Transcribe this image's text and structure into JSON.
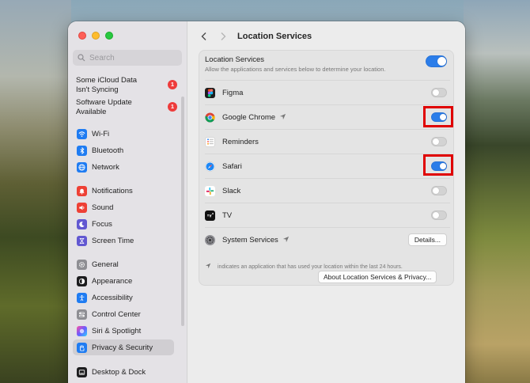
{
  "sidebar": {
    "search_placeholder": "Search",
    "alerts": [
      {
        "line1": "Some iCloud Data",
        "line2": "Isn't Syncing",
        "badge": "1"
      },
      {
        "line1": "Software Update",
        "line2": "Available",
        "badge": "1"
      }
    ],
    "items": [
      {
        "label": "Wi-Fi",
        "icon": "wifi-icon",
        "color": "#1f7cf2"
      },
      {
        "label": "Bluetooth",
        "icon": "bluetooth-icon",
        "color": "#1f7cf2"
      },
      {
        "label": "Network",
        "icon": "globe-icon",
        "color": "#1f7cf2"
      },
      {
        "label": "Notifications",
        "icon": "bell-icon",
        "color": "#ee4035"
      },
      {
        "label": "Sound",
        "icon": "speaker-icon",
        "color": "#ee4035"
      },
      {
        "label": "Focus",
        "icon": "moon-icon",
        "color": "#6258d1"
      },
      {
        "label": "Screen Time",
        "icon": "hourglass-icon",
        "color": "#6258d1"
      },
      {
        "label": "General",
        "icon": "gear-icon",
        "color": "#8e8e93"
      },
      {
        "label": "Appearance",
        "icon": "appearance-icon",
        "color": "#1c1c1e"
      },
      {
        "label": "Accessibility",
        "icon": "accessibility-icon",
        "color": "#1f7cf2"
      },
      {
        "label": "Control Center",
        "icon": "control-center-icon",
        "color": "#8e8e93"
      },
      {
        "label": "Siri & Spotlight",
        "icon": "siri-icon",
        "color": "#9b5de5"
      },
      {
        "label": "Privacy & Security",
        "icon": "hand-icon",
        "color": "#1f7cf2"
      },
      {
        "label": "Desktop & Dock",
        "icon": "dock-icon",
        "color": "#1c1c1e"
      }
    ]
  },
  "header": {
    "title": "Location Services"
  },
  "location": {
    "title": "Location Services",
    "description": "Allow the applications and services below to determine your location.",
    "enabled": true
  },
  "apps": [
    {
      "label": "Figma",
      "icon": "figma-icon",
      "enabled": false,
      "recent": false
    },
    {
      "label": "Google Chrome",
      "icon": "chrome-icon",
      "enabled": true,
      "recent": true
    },
    {
      "label": "Reminders",
      "icon": "reminders-icon",
      "enabled": false,
      "recent": false
    },
    {
      "label": "Safari",
      "icon": "safari-icon",
      "enabled": true,
      "recent": false
    },
    {
      "label": "Slack",
      "icon": "slack-icon",
      "enabled": false,
      "recent": false
    },
    {
      "label": "TV",
      "icon": "tv-icon",
      "enabled": false,
      "recent": false
    }
  ],
  "system_services": {
    "label": "System Services",
    "details_label": "Details..."
  },
  "footnote": "indicates an application that has used your location within the last 24 hours.",
  "about_label": "About Location Services & Privacy...",
  "colors": {
    "accent": "#2b7de9",
    "highlight": "#e00000",
    "badge": "#ee3b3b"
  }
}
